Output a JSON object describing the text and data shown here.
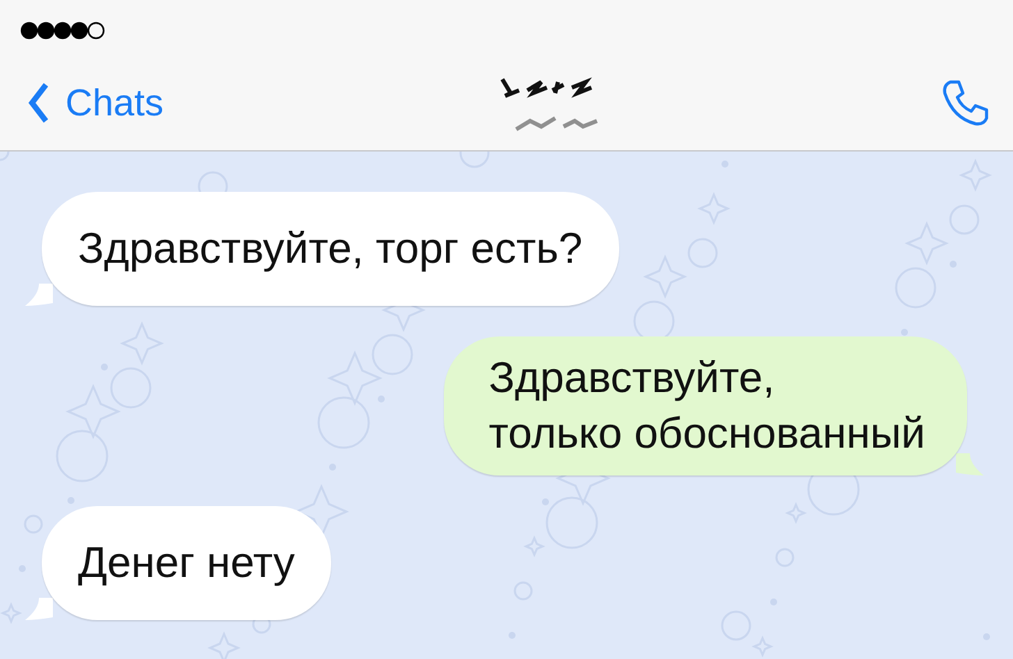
{
  "nav": {
    "back_label": "Chats"
  },
  "messages": [
    {
      "kind": "incoming",
      "text": "Здравствуйте, торг есть?"
    },
    {
      "kind": "outgoing",
      "text": "Здравствуйте,\nтолько обоснованный"
    },
    {
      "kind": "incoming",
      "text": "Денег нету"
    }
  ]
}
